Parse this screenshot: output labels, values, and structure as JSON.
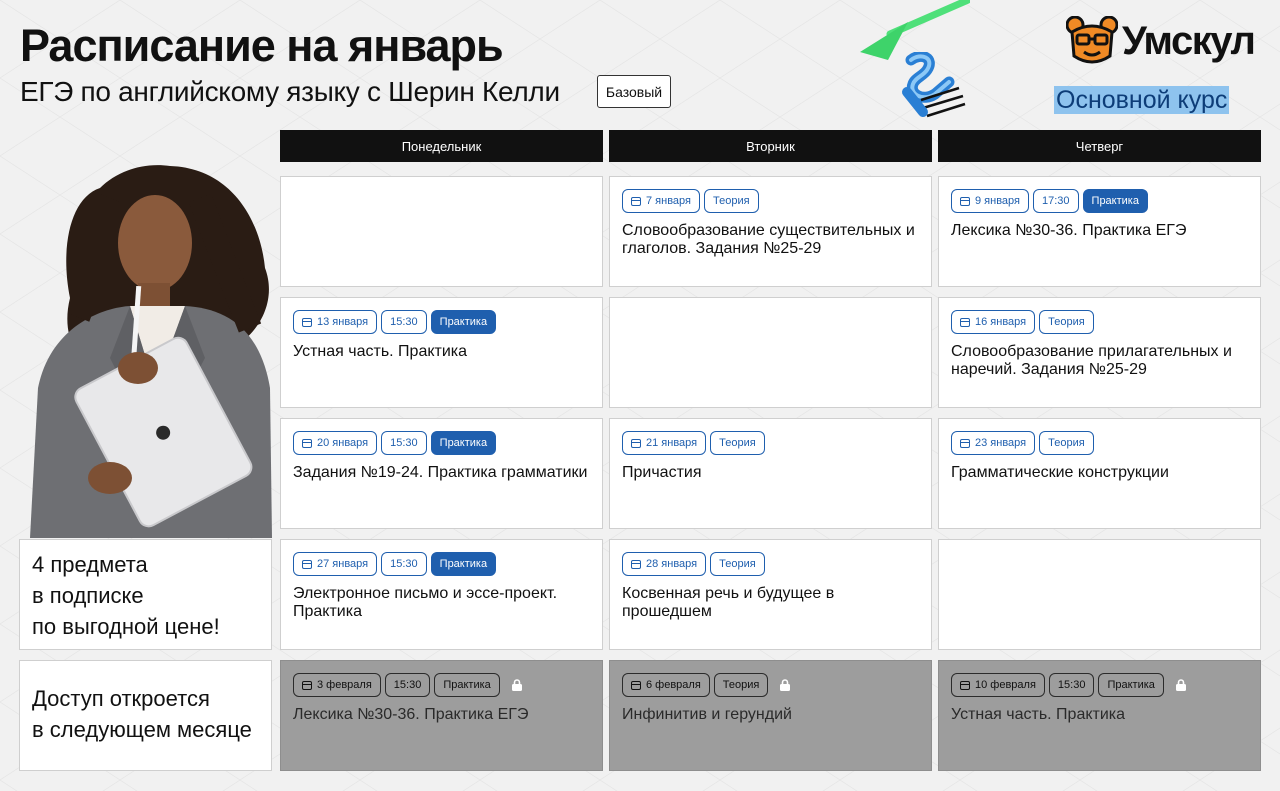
{
  "header": {
    "title": "Расписание на январь",
    "subtitle": "ЕГЭ по английскому языку с Шерин Келли",
    "level_badge": "Базовый"
  },
  "brand": {
    "logo_text": "Умскул",
    "course_label": "Основной курс",
    "accent_color": "#1f5fae",
    "highlight_color": "#8ec3ee",
    "logo_color": "#f08a25"
  },
  "days": [
    "Понедельник",
    "Вторник",
    "Четверг"
  ],
  "schedule": {
    "w1_mon": null,
    "w1_tue": {
      "date": "7 января",
      "type": "Теория",
      "title": "Словообразование существительных и глаголов. Задания №25-29"
    },
    "w1_thu": {
      "date": "9 января",
      "time": "17:30",
      "type": "Практика",
      "title": "Лексика №30-36. Практика ЕГЭ"
    },
    "w2_mon": {
      "date": "13 января",
      "time": "15:30",
      "type": "Практика",
      "title": "Устная часть. Практика"
    },
    "w2_tue": null,
    "w2_thu": {
      "date": "16 января",
      "type": "Теория",
      "title": "Словообразование прилагательных и наречий. Задания №25-29"
    },
    "w3_mon": {
      "date": "20 января",
      "time": "15:30",
      "type": "Практика",
      "title": "Задания №19-24. Практика грамматики"
    },
    "w3_tue": {
      "date": "21 января",
      "type": "Теория",
      "title": "Причастия"
    },
    "w3_thu": {
      "date": "23 января",
      "type": "Теория",
      "title": "Грамматические конструкции"
    },
    "w4_mon": {
      "date": "27 января",
      "time": "15:30",
      "type": "Практика",
      "title": "Электронное письмо и эссе-проект. Практика"
    },
    "w4_tue": {
      "date": "28 января",
      "type": "Теория",
      "title": "Косвенная речь и будущее в прошедшем"
    },
    "w4_thu": null,
    "w5_mon": {
      "date": "3 февраля",
      "time": "15:30",
      "type": "Практика",
      "title": "Лексика №30-36. Практика ЕГЭ",
      "locked": true
    },
    "w5_tue": {
      "date": "6 февраля",
      "type": "Теория",
      "title": "Инфинитив и герундий",
      "locked": true
    },
    "w5_thu": {
      "date": "10 февраля",
      "time": "15:30",
      "type": "Практика",
      "title": "Устная часть. Практика",
      "locked": true
    }
  },
  "promo": {
    "line1": "4 предмета",
    "line2": "в подписке",
    "line3": "по выгодной цене!"
  },
  "locked_note": {
    "line1": "Доступ откроется",
    "line2": "в следующем месяце"
  }
}
